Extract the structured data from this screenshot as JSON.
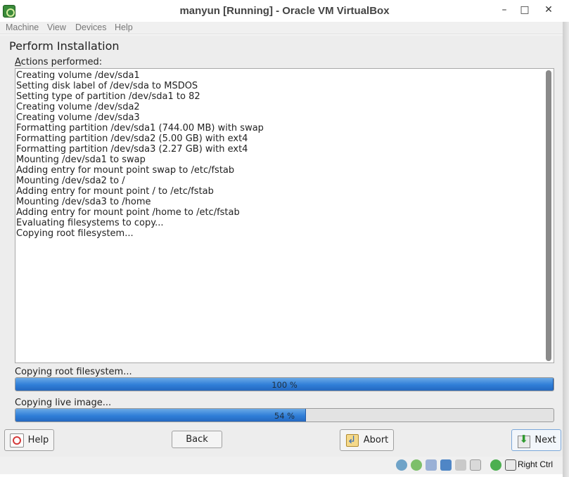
{
  "window": {
    "title": "manyun [Running] - Oracle VM VirtualBox",
    "minimize_glyph": "–",
    "maximize_glyph": "□",
    "close_glyph": "✕"
  },
  "menu": {
    "items": [
      {
        "label": "Machine"
      },
      {
        "label": "View"
      },
      {
        "label": "Devices"
      },
      {
        "label": "Help"
      }
    ]
  },
  "installer": {
    "title": "Perform Installation",
    "actions_label_mnemonic": "A",
    "actions_label_rest": "ctions performed:",
    "log": [
      "Creating volume /dev/sda1",
      "Setting disk label of /dev/sda to MSDOS",
      "Setting type of partition /dev/sda1 to 82",
      "Creating volume /dev/sda2",
      "Creating volume /dev/sda3",
      "Formatting partition /dev/sda1 (744.00 MB) with swap",
      "Formatting partition /dev/sda2 (5.00 GB) with ext4",
      "Formatting partition /dev/sda3 (2.27 GB) with ext4",
      "Mounting /dev/sda1 to swap",
      "Adding entry for mount point swap to /etc/fstab",
      "Mounting /dev/sda2 to /",
      "Adding entry for mount point / to /etc/fstab",
      "Mounting /dev/sda3 to /home",
      "Adding entry for mount point /home to /etc/fstab",
      "Evaluating filesystems to copy...",
      "Copying root filesystem..."
    ],
    "progress": [
      {
        "label": "Copying root filesystem...",
        "percent": 100,
        "text": "100 %"
      },
      {
        "label": "Copying live image...",
        "percent": 54,
        "text": "54 %"
      }
    ],
    "buttons": {
      "help": "Help",
      "back": "Back",
      "abort": "Abort",
      "next": "Next"
    }
  },
  "statusbar": {
    "host_key": "Right Ctrl",
    "icons": [
      "hard-disk-icon",
      "optical-drive-icon",
      "usb-icon",
      "shared-folders-icon",
      "display-icon",
      "video-capture-icon",
      "network-icon",
      "mouse-integration-icon"
    ]
  }
}
